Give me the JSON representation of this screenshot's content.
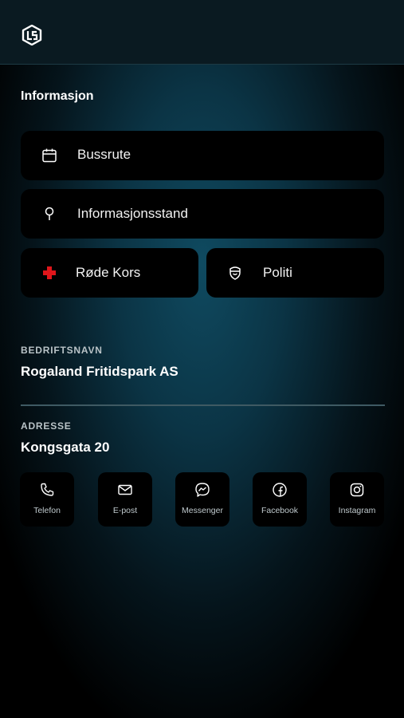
{
  "header": {
    "logo": "app-logo"
  },
  "section_title": "Informasjon",
  "menu": {
    "bussrute": {
      "label": "Bussrute",
      "icon": "calendar-icon"
    },
    "infostand": {
      "label": "Informasjonsstand",
      "icon": "map-pin-icon"
    },
    "rode_kors": {
      "label": "Røde Kors",
      "icon": "red-cross-icon",
      "icon_color": "#e0161b"
    },
    "politi": {
      "label": "Politi",
      "icon": "police-badge-icon"
    }
  },
  "company": {
    "label": "BEDRIFTSNAVN",
    "value": "Rogaland Fritidspark AS"
  },
  "address": {
    "label": "ADRESSE",
    "value": "Kongsgata 20"
  },
  "contacts": [
    {
      "label": "Telefon",
      "icon": "phone-icon"
    },
    {
      "label": "E-post",
      "icon": "mail-icon"
    },
    {
      "label": "Messenger",
      "icon": "messenger-icon"
    },
    {
      "label": "Facebook",
      "icon": "facebook-icon"
    },
    {
      "label": "Instagram",
      "icon": "instagram-icon"
    }
  ],
  "colors": {
    "background": "#000000",
    "glow": "#0f4a60",
    "card": "#000000",
    "accent_red": "#e0161b"
  }
}
